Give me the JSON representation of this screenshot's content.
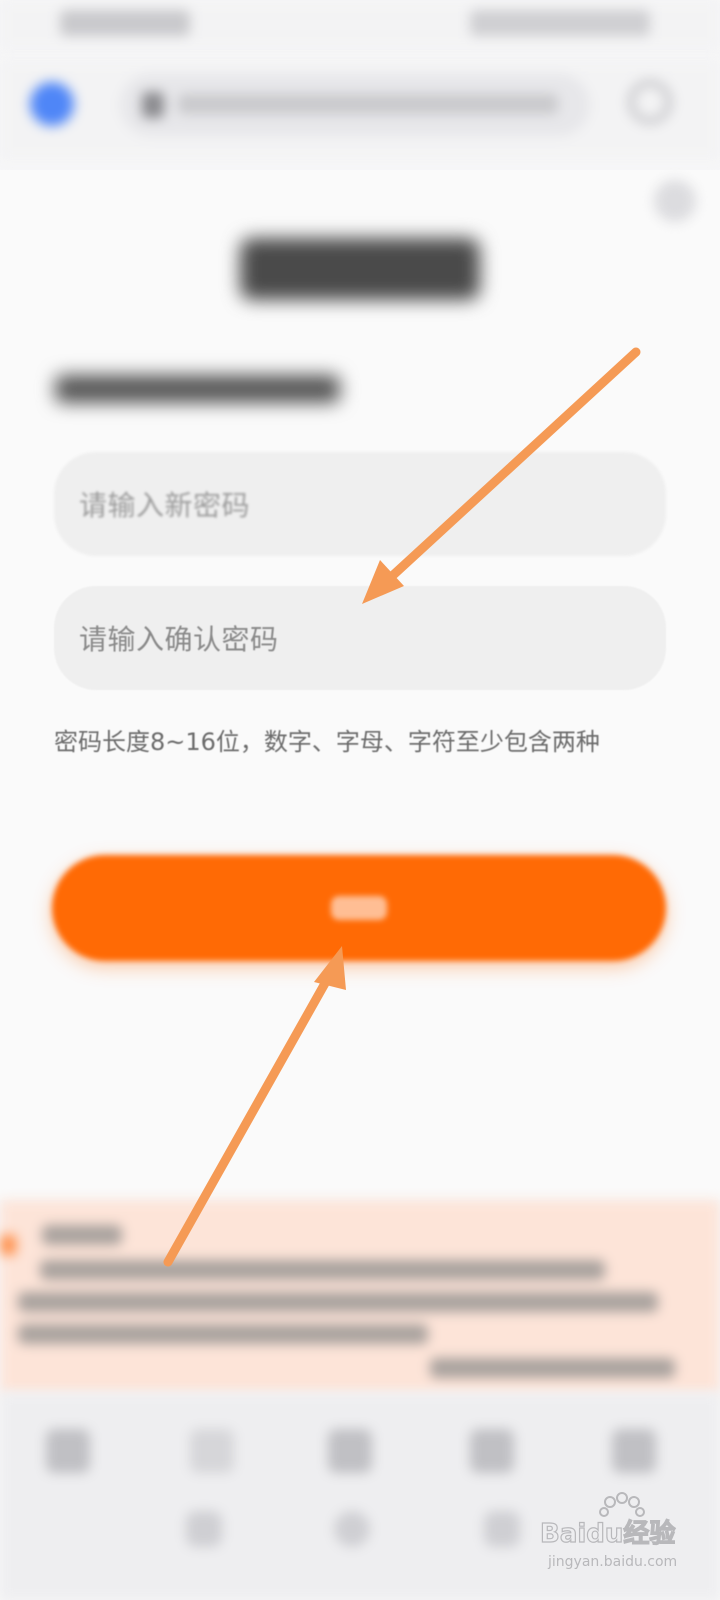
{
  "form": {
    "new_password_placeholder": "请输入新密码",
    "confirm_password_placeholder": "请输入确认密码",
    "hint": "密码长度8~16位，数字、字母、字符至少包含两种"
  },
  "watermark": {
    "logo_text": "Baidu经验",
    "url": "jingyan.baidu.com"
  },
  "colors": {
    "accent": "#ff6a05",
    "arrow": "#f59a55",
    "notice_bg": "#fde4d8"
  }
}
